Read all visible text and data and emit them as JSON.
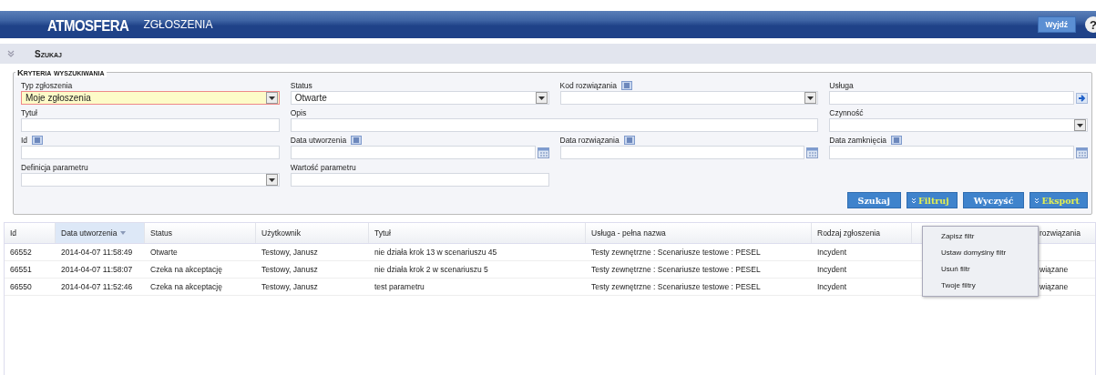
{
  "header": {
    "logo": "ATMOSFERA",
    "title": "ZGŁOSZENIA",
    "logout": "Wyjdź",
    "help": "?"
  },
  "section": {
    "title": "Szukaj",
    "expanded": true
  },
  "criteria": {
    "title": "Kryteria wyszukiwania",
    "fields": [
      {
        "label": "Typ zgłoszenia",
        "kind": "select",
        "value": "Moje zgłoszenia",
        "highlighted": true,
        "filter_icon": false,
        "wide": false
      },
      {
        "label": "Status",
        "kind": "select",
        "value": "Otwarte",
        "highlighted": false,
        "filter_icon": false,
        "wide": false
      },
      {
        "label": "Kod rozwiązania",
        "kind": "select",
        "highlighted": false,
        "filter_icon": true,
        "wide": false
      },
      {
        "label": "Usługa",
        "kind": "lookup",
        "highlighted": false,
        "filter_icon": false,
        "wide": false
      },
      {
        "label": "Tytuł",
        "kind": "text",
        "highlighted": false,
        "filter_icon": false,
        "wide": false
      },
      {
        "label": "Opis",
        "kind": "text",
        "highlighted": false,
        "filter_icon": false,
        "wide": true
      },
      {
        "label": "Czynność",
        "kind": "select",
        "highlighted": false,
        "filter_icon": false,
        "wide": false
      },
      {
        "label": "Id",
        "kind": "text",
        "highlighted": false,
        "filter_icon": true,
        "wide": false
      },
      {
        "label": "Data utworzenia",
        "kind": "date",
        "highlighted": false,
        "filter_icon": true,
        "wide": false
      },
      {
        "label": "Data rozwiązania",
        "kind": "date",
        "highlighted": false,
        "filter_icon": true,
        "wide": false
      },
      {
        "label": "Data zamknięcia",
        "kind": "date",
        "highlighted": false,
        "filter_icon": true,
        "wide": false
      },
      {
        "label": "Definicja parametru",
        "kind": "select",
        "highlighted": false,
        "filter_icon": false,
        "wide": false
      },
      {
        "label": "Wartość parametru",
        "kind": "text",
        "highlighted": false,
        "filter_icon": false,
        "wide": false
      }
    ]
  },
  "buttons": [
    {
      "label": "Szukaj",
      "kind": "plain"
    },
    {
      "label": "Filtruj",
      "kind": "menu"
    },
    {
      "label": "Wyczyść",
      "kind": "plain"
    },
    {
      "label": "Eksport",
      "kind": "menu"
    }
  ],
  "filter_menu": [
    "Zapisz filtr",
    "Ustaw domyślny filtr",
    "Usuń filtr",
    "Twoje filtry"
  ],
  "table": {
    "columns": [
      {
        "label": "Id",
        "sorted": false
      },
      {
        "label": "Data utworzenia",
        "sorted": true
      },
      {
        "label": "Status",
        "sorted": false
      },
      {
        "label": "Użytkownik",
        "sorted": false
      },
      {
        "label": "Tytuł",
        "sorted": false
      },
      {
        "label": "Usługa - pełna nazwa",
        "sorted": false
      },
      {
        "label": "Rodzaj zgłoszenia",
        "sorted": false
      },
      {
        "label": "rozwiązania",
        "sorted": false
      }
    ],
    "rows": [
      [
        "66552",
        "2014-04-07 11:58:49",
        "Otwarte",
        "Testowy, Janusz",
        "nie działa krok 13 w scenariuszu 45",
        "Testy zewnętrzne : Scenariusze testowe : PESEL",
        "Incydent",
        ""
      ],
      [
        "66551",
        "2014-04-07 11:58:07",
        "Czeka na akceptację",
        "Testowy, Janusz",
        "nie działa krok 2 w scenariuszu 5",
        "Testy zewnętrzne : Scenariusze testowe : PESEL",
        "Incydent",
        "wiązane"
      ],
      [
        "66550",
        "2014-04-07 11:52:46",
        "Czeka na akceptację",
        "Testowy, Janusz",
        "test parametru",
        "Testy zewnętrzne : Scenariusze testowe : PESEL",
        "Incydent",
        "wiązane"
      ]
    ]
  }
}
